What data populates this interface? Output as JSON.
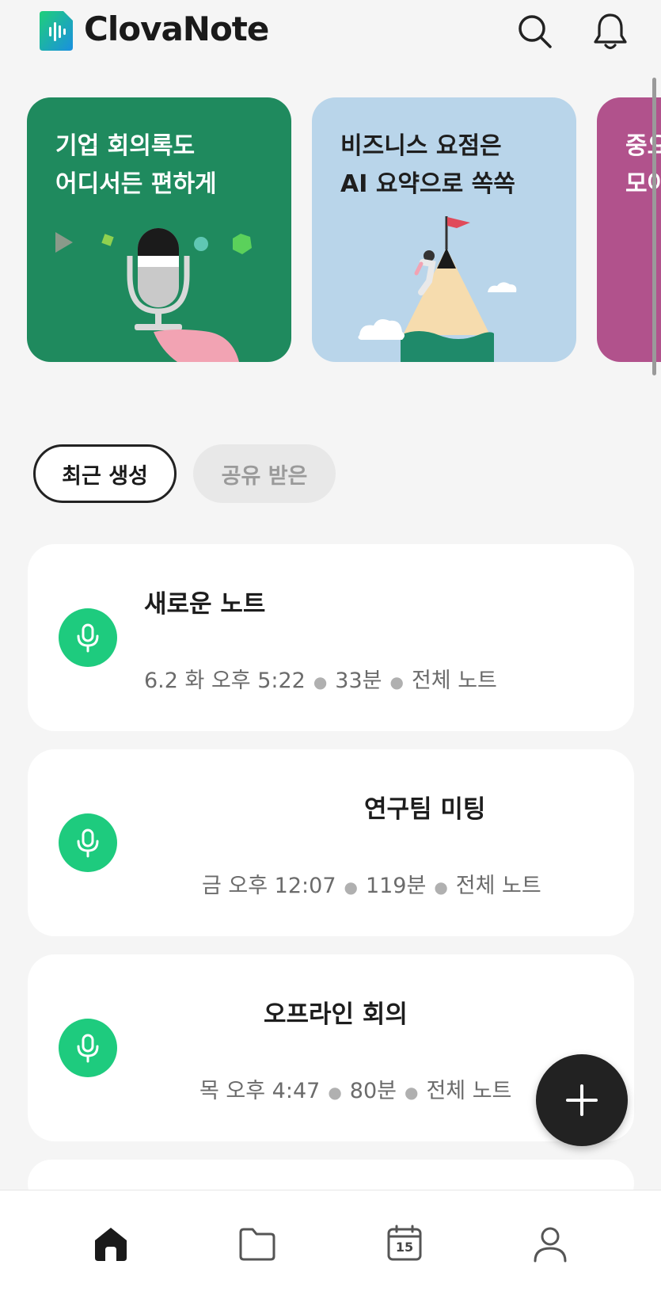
{
  "app": {
    "title": "ClovaNote"
  },
  "banners": [
    {
      "line1": "기업 회의록도",
      "line2": "어디서든 편하게",
      "color": "#1f8a5e"
    },
    {
      "line1": "비즈니스 요점은",
      "line2": "AI 요약으로 쏙쏙",
      "color": "#b9d5ea"
    },
    {
      "line1": "중요",
      "line2": "모아",
      "color": "#b1528c"
    }
  ],
  "filters": {
    "recent": "최근 생성",
    "shared": "공유 받은"
  },
  "notes": [
    {
      "title": "새로운 노트",
      "datetime": "6.2 화 오후 5:22",
      "duration": "33분",
      "folder": "전체 노트"
    },
    {
      "title": "연구팀 미팅",
      "datetime": "금 오후 12:07",
      "duration": "119분",
      "folder": "전체 노트"
    },
    {
      "title": "오프라인 회의",
      "datetime": "목 오후 4:47",
      "duration": "80분",
      "folder": "전체 노트"
    }
  ],
  "calendar": {
    "day": "15"
  },
  "colors": {
    "accent_green": "#1ecb7e",
    "fab": "#222222"
  }
}
